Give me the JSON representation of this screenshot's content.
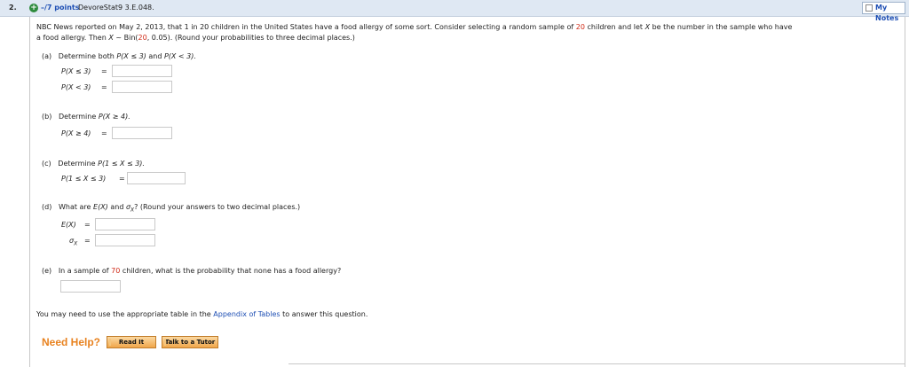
{
  "header": {
    "question_number": "2.",
    "points": "–/7 points",
    "question_id": "DevoreStat9 3.E.048.",
    "my_notes": "My Notes"
  },
  "prompt": {
    "line1_a": "NBC News reported on May 2, 2013, that 1 in 20 children in the United States have a food allergy of some sort. Consider selecting a random sample of ",
    "n": "20",
    "line1_b": " children and let ",
    "var_x": "X",
    "line1_c": " be the number in the sample who have",
    "line2_a": "a food allergy. Then ",
    "line2_b": " ~ Bin(",
    "line2_n": "20",
    "line2_c": ", 0.05). (Round your probabilities to three decimal places.)"
  },
  "part_a": {
    "label": "(a)",
    "instruction_prefix": "Determine both ",
    "instruction_p1": "P(X ≤ 3)",
    "instruction_and": " and ",
    "instruction_p2": "P(X < 3).",
    "row1_label": "P(X ≤ 3)",
    "row2_label": "P(X < 3)",
    "row1_value": "",
    "row2_value": ""
  },
  "part_b": {
    "label": "(b)",
    "instruction_prefix": "Determine ",
    "instruction_p": "P(X ≥ 4).",
    "row_label": "P(X ≥ 4)",
    "row_value": ""
  },
  "part_c": {
    "label": "(c)",
    "instruction_prefix": "Determine ",
    "instruction_p": "P(1 ≤ X ≤ 3).",
    "row_label": "P(1 ≤ X ≤ 3)",
    "row_value": ""
  },
  "part_d": {
    "label": "(d)",
    "instruction_a": "What are ",
    "ex": "E(X)",
    "instruction_and": " and ",
    "sigma": "σ",
    "sigma_sub": "X",
    "instruction_b": "? (Round your answers to two decimal places.)",
    "row1_label": "E(X)",
    "row2_label": "σ",
    "row2_sub": "X",
    "row1_value": "",
    "row2_value": ""
  },
  "part_e": {
    "label": "(e)",
    "instruction_a": "In a sample of ",
    "n": "70",
    "instruction_b": " children, what is the probability that none has a food allergy?",
    "value": ""
  },
  "footer_note": {
    "a": "You may need to use the appropriate table in the ",
    "link": "Appendix of Tables",
    "b": " to answer this question."
  },
  "help": {
    "label": "Need Help?",
    "read_it": "Read It",
    "talk_tutor": "Talk to a Tutor"
  },
  "symbols": {
    "equals": "=",
    "x": "X"
  },
  "colors": {
    "header_bg": "#dfe8f3",
    "red_value": "#d02a17",
    "link": "#1e4fb4",
    "help": "#e8821f"
  }
}
